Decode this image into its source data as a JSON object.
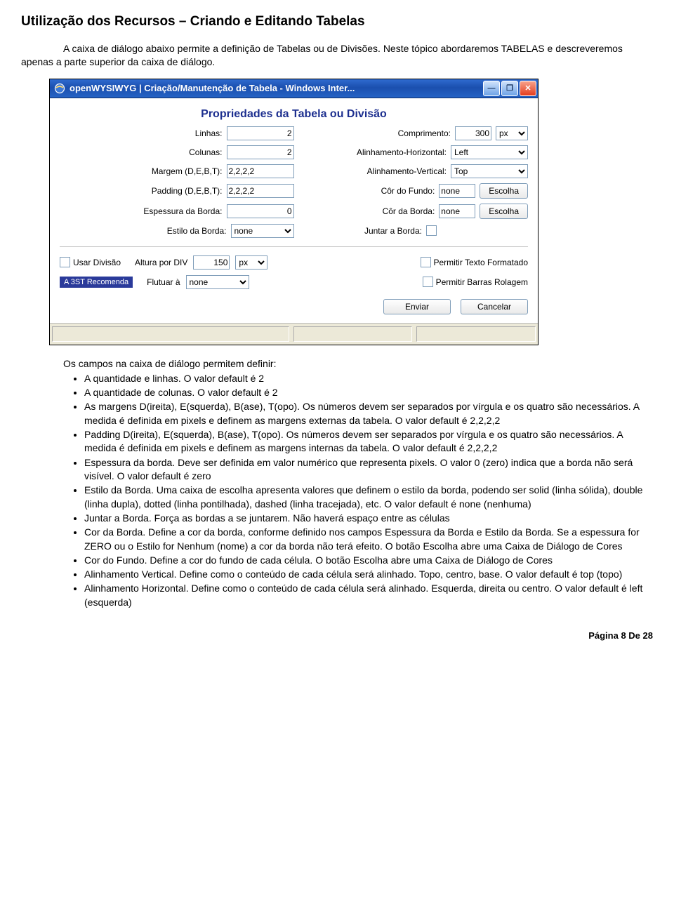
{
  "doc": {
    "title": "Utilização dos Recursos – Criando e Editando Tabelas",
    "intro": "A caixa de diálogo abaixo permite a definição de Tabelas ou de Divisões. Neste tópico abordaremos TABELAS e descreveremos apenas a parte superior da caixa de diálogo.",
    "lead": "Os campos na caixa de diálogo permitem definir:",
    "footer": "Página 8 De 28"
  },
  "win": {
    "title": "openWYSIWYG  |  Criação/Manutenção de Tabela - Windows Inter...",
    "legend": "Propriedades da Tabela ou Divisão",
    "labels": {
      "linhas": "Linhas:",
      "colunas": "Colunas:",
      "margem": "Margem (D,E,B,T):",
      "padding": "Padding (D,E,B,T):",
      "espessura": "Espessura da Borda:",
      "estilo": "Estilo da Borda:",
      "comprimento": "Comprimento:",
      "alinh_h": "Alinhamento-Horizontal:",
      "alinh_v": "Alinhamento-Vertical:",
      "cor_fundo": "Côr do Fundo:",
      "cor_borda": "Côr da Borda:",
      "juntar": "Juntar a Borda:",
      "usar_div": "Usar Divisão",
      "altura_div": "Altura por DIV",
      "flutuar": "Flutuar à",
      "perm_txt": "Permitir Texto Formatado",
      "perm_scroll": "Permitir Barras Rolagem",
      "recomenda": "A 3ST Recomenda",
      "enviar": "Enviar",
      "cancelar": "Cancelar",
      "escolha": "Escolha"
    },
    "values": {
      "linhas": "2",
      "colunas": "2",
      "margem": "2,2,2,2",
      "padding": "2,2,2,2",
      "espessura": "0",
      "estilo": "none",
      "comprimento": "300",
      "comp_unit": "px",
      "alinh_h": "Left",
      "alinh_v": "Top",
      "cor_fundo": "none",
      "cor_borda": "none",
      "altura_div": "150",
      "altura_unit": "px",
      "flutuar": "none"
    }
  },
  "bullets": {
    "b1": "A quantidade e linhas. O valor default é 2",
    "b2": "A quantidade de colunas. O valor default é 2",
    "b3": "As margens D(ireita), E(squerda), B(ase), T(opo). Os números devem ser separados por vírgula e os quatro são necessários. A medida é definida em pixels e definem as margens externas da tabela. O valor default é 2,2,2,2",
    "b4": "Padding D(ireita), E(squerda), B(ase), T(opo). Os números devem ser separados por vírgula e os quatro são necessários. A medida é definida em pixels e definem as margens internas da tabela. O valor default é 2,2,2,2",
    "b5": "Espessura da borda. Deve ser definida em valor numérico que representa pixels. O valor 0 (zero) indica que a borda não será visível. O valor default é zero",
    "b6": "Estilo da Borda. Uma caixa de escolha apresenta valores que definem o estilo da borda, podendo ser solid (linha sólida), double (linha dupla), dotted (linha pontilhada), dashed (linha tracejada), etc. O valor default é none (nenhuma)",
    "b7": "Juntar a Borda. Força as bordas a se juntarem. Não haverá espaço entre as células",
    "b8": "Cor da Borda. Define a cor da borda, conforme definido nos campos Espessura da Borda e Estilo da Borda. Se a espessura for ZERO ou o Estilo for Nenhum (nome) a cor da borda não terá efeito. O botão Escolha abre uma Caixa de Diálogo de Cores",
    "b9": "Cor do Fundo. Define a cor do fundo de cada célula. O botão Escolha abre uma Caixa de Diálogo de Cores",
    "b10": "Alinhamento Vertical. Define como o conteúdo de cada célula será alinhado. Topo, centro, base. O valor default é top (topo)",
    "b11": "Alinhamento Horizontal. Define como o conteúdo de cada célula será alinhado. Esquerda, direita ou centro. O valor default é left (esquerda)"
  }
}
